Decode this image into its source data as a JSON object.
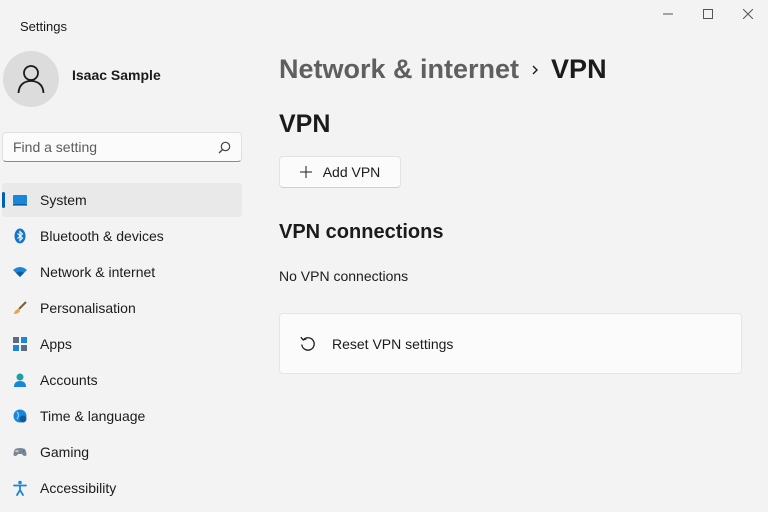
{
  "window": {
    "title": "Settings"
  },
  "user": {
    "name": "Isaac Sample"
  },
  "search": {
    "placeholder": "Find a setting"
  },
  "sidebar": {
    "items": [
      {
        "label": "System",
        "icon": "monitor-icon",
        "active": true
      },
      {
        "label": "Bluetooth & devices",
        "icon": "bluetooth-icon"
      },
      {
        "label": "Network & internet",
        "icon": "wifi-icon"
      },
      {
        "label": "Personalisation",
        "icon": "brush-icon"
      },
      {
        "label": "Apps",
        "icon": "apps-icon"
      },
      {
        "label": "Accounts",
        "icon": "person-icon"
      },
      {
        "label": "Time & language",
        "icon": "globe-clock-icon"
      },
      {
        "label": "Gaming",
        "icon": "gamepad-icon"
      },
      {
        "label": "Accessibility",
        "icon": "accessibility-icon"
      }
    ]
  },
  "breadcrumb": {
    "parent": "Network & internet",
    "current": "VPN"
  },
  "vpn": {
    "title": "VPN",
    "add_label": "Add VPN",
    "connections_title": "VPN connections",
    "empty_text": "No VPN connections",
    "reset_label": "Reset VPN settings"
  },
  "colors": {
    "accent": "#005fb8",
    "background": "#f3f3f3",
    "card": "#fbfbfb"
  }
}
